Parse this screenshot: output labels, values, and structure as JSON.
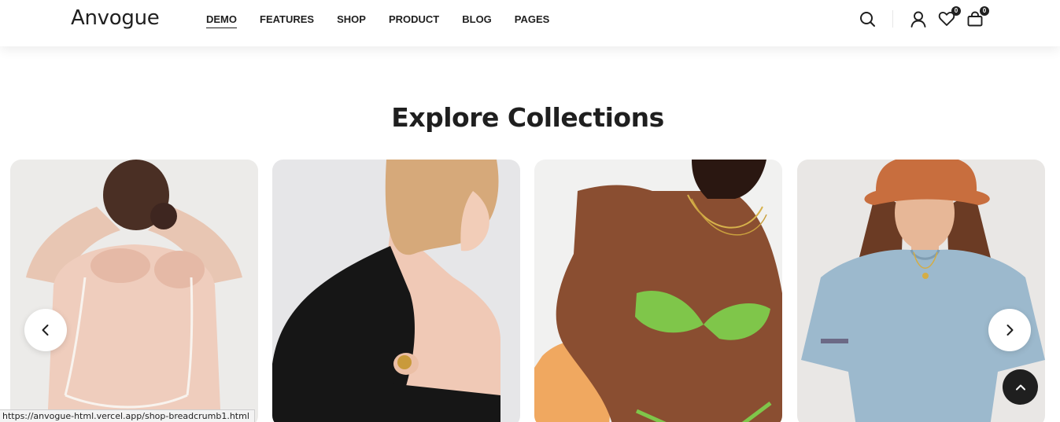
{
  "header": {
    "logo": "Anvogue",
    "nav": [
      {
        "label": "DEMO",
        "active": true
      },
      {
        "label": "FEATURES"
      },
      {
        "label": "SHOP"
      },
      {
        "label": "PRODUCT"
      },
      {
        "label": "BLOG"
      },
      {
        "label": "PAGES"
      }
    ],
    "icons": [
      "search-icon",
      "user-icon",
      "heart-icon",
      "cart-icon"
    ],
    "wishlist_count": "0",
    "cart_count": "0"
  },
  "section": {
    "title": "Explore Collections"
  },
  "collections": [
    {
      "image": "woman-back-lingerie"
    },
    {
      "image": "woman-black-blazer"
    },
    {
      "image": "woman-green-bikini"
    },
    {
      "image": "woman-blue-tshirt-hat"
    }
  ],
  "controls": {
    "prev_icon": "chevron-left-icon",
    "next_icon": "chevron-right-icon",
    "back_to_top_icon": "chevron-up-icon"
  },
  "status_bar": {
    "url": "https://anvogue-html.vercel.app/shop-breadcrumb1.html"
  },
  "colors": {
    "text": "#1f1f1f",
    "background": "#ffffff",
    "accent_dark": "#1f1f1f"
  }
}
